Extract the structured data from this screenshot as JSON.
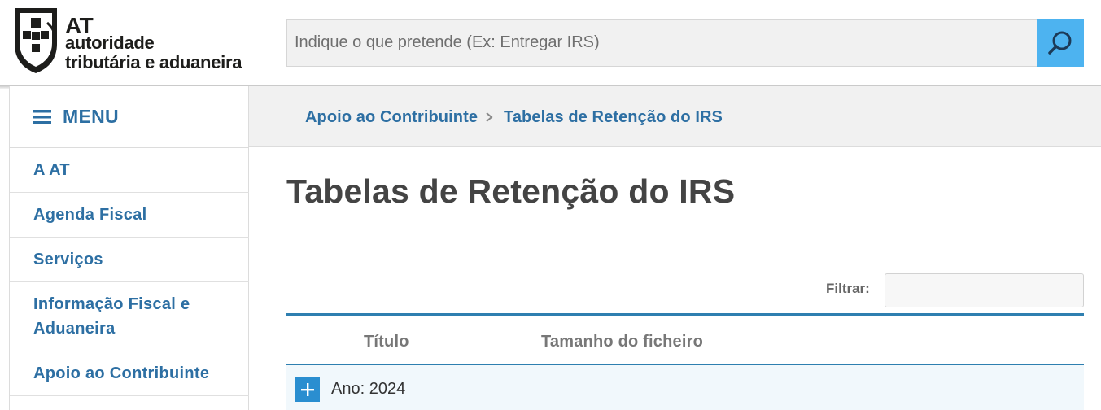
{
  "header": {
    "logo": {
      "short": "AT",
      "line1": "autoridade",
      "line2": "tributária e aduaneira"
    },
    "search": {
      "placeholder": "Indique o que pretende (Ex: Entregar IRS)",
      "value": "",
      "button_icon": "search-icon"
    }
  },
  "sidebar": {
    "menu_label": "MENU",
    "menu_icon": "hamburger-icon",
    "items": [
      {
        "label": "A AT"
      },
      {
        "label": "Agenda Fiscal"
      },
      {
        "label": "Serviços"
      },
      {
        "label": "Informação Fiscal e Aduaneira"
      },
      {
        "label": "Apoio ao Contribuinte"
      }
    ]
  },
  "breadcrumb": {
    "items": [
      {
        "label": "Apoio ao Contribuinte"
      },
      {
        "label": "Tabelas de Retenção do IRS"
      }
    ],
    "separator_icon": "chevron-right-icon"
  },
  "main": {
    "title": "Tabelas de Retenção do IRS",
    "filter": {
      "label": "Filtrar:",
      "value": ""
    },
    "table": {
      "columns": [
        "Título",
        "Tamanho do ficheiro"
      ],
      "groups": [
        {
          "label": "Ano: 2024",
          "expand_icon": "plus-icon",
          "expanded": false
        }
      ]
    }
  },
  "colors": {
    "link_blue": "#2d6fa3",
    "search_button": "#4db3f0",
    "table_accent": "#2e7fb0",
    "expand_button": "#2a8ed0"
  }
}
